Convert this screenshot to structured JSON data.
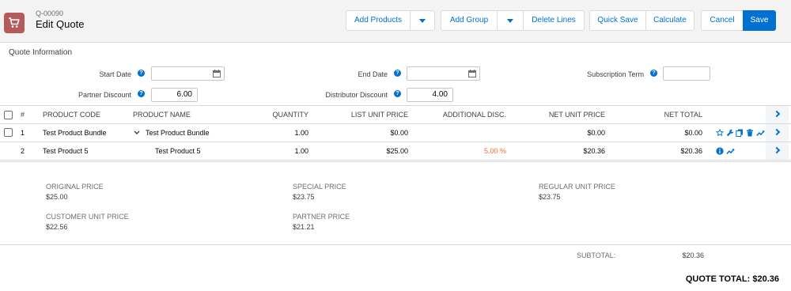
{
  "header": {
    "quote_number": "Q-00090",
    "title": "Edit Quote",
    "buttons": {
      "add_products": "Add Products",
      "add_group": "Add Group",
      "delete_lines": "Delete Lines",
      "quick_save": "Quick Save",
      "calculate": "Calculate",
      "cancel": "Cancel",
      "save": "Save"
    }
  },
  "quote_info": {
    "section_title": "Quote Information",
    "start_date_label": "Start Date",
    "start_date_value": "",
    "end_date_label": "End Date",
    "end_date_value": "",
    "subscription_term_label": "Subscription Term",
    "subscription_term_value": "",
    "partner_discount_label": "Partner Discount",
    "partner_discount_value": "6.00",
    "distributor_discount_label": "Distributor Discount",
    "distributor_discount_value": "4.00",
    "help_glyph": "?"
  },
  "table": {
    "columns": {
      "number": "#",
      "product_code": "PRODUCT CODE",
      "product_name": "PRODUCT NAME",
      "quantity": "QUANTITY",
      "list_unit_price": "LIST UNIT PRICE",
      "additional_disc": "ADDITIONAL DISC.",
      "net_unit_price": "NET UNIT PRICE",
      "net_total": "NET TOTAL"
    },
    "rows": [
      {
        "number": "1",
        "product_code": "Test Product Bundle",
        "product_name": "Test Product Bundle",
        "quantity": "1.00",
        "list_unit_price": "$0.00",
        "additional_disc": "",
        "net_unit_price": "$0.00",
        "net_total": "$0.00",
        "icons": [
          "star-icon",
          "wrench-icon",
          "copy-icon",
          "trash-icon",
          "trend-icon"
        ]
      },
      {
        "number": "2",
        "product_code": "Test Product 5",
        "product_name": "Test Product 5",
        "quantity": "1.00",
        "list_unit_price": "$25.00",
        "additional_disc": "5.00 %",
        "net_unit_price": "$20.36",
        "net_total": "$20.36",
        "icons": [
          "info-icon",
          "trend-icon"
        ]
      }
    ]
  },
  "details": {
    "original_price_label": "ORIGINAL PRICE",
    "original_price_value": "$25.00",
    "special_price_label": "SPECIAL PRICE",
    "special_price_value": "$23.75",
    "regular_unit_price_label": "REGULAR UNIT PRICE",
    "regular_unit_price_value": "$23.75",
    "customer_unit_price_label": "CUSTOMER UNIT PRICE",
    "customer_unit_price_value": "$22.56",
    "partner_price_label": "PARTNER PRICE",
    "partner_price_value": "$21.21"
  },
  "totals": {
    "subtotal_label": "SUBTOTAL:",
    "subtotal_value": "$20.36",
    "quote_total": "QUOTE TOTAL: $20.36"
  },
  "colors": {
    "brand_blue": "#0070d2",
    "icon_bg": "#b55a5a",
    "discount_orange": "#ea7029",
    "header_bg": "#f3f3f3",
    "border": "#dddbda"
  }
}
